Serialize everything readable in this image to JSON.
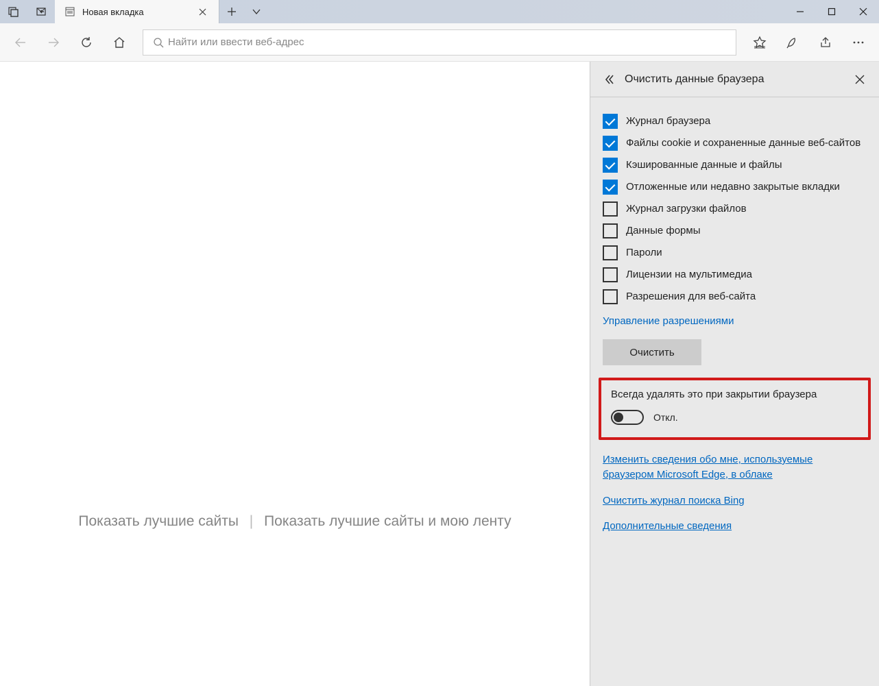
{
  "titlebar": {
    "tab_title": "Новая вкладка"
  },
  "toolbar": {
    "address_placeholder": "Найти или ввести веб-адрес"
  },
  "content": {
    "link_top_sites": "Показать лучшие сайты",
    "link_top_sites_feed": "Показать лучшие сайты и мою ленту"
  },
  "panel": {
    "title": "Очистить данные браузера",
    "checks": [
      {
        "label": "Журнал браузера",
        "checked": true
      },
      {
        "label": "Файлы cookie и сохраненные данные веб-сайтов",
        "checked": true
      },
      {
        "label": "Кэшированные данные и файлы",
        "checked": true
      },
      {
        "label": "Отложенные или недавно закрытые вкладки",
        "checked": true
      },
      {
        "label": "Журнал загрузки файлов",
        "checked": false
      },
      {
        "label": "Данные формы",
        "checked": false
      },
      {
        "label": "Пароли",
        "checked": false
      },
      {
        "label": "Лицензии на мультимедиа",
        "checked": false
      },
      {
        "label": "Разрешения для веб-сайта",
        "checked": false
      }
    ],
    "manage_permissions": "Управление разрешениями",
    "clear_button": "Очистить",
    "always_clear_title": "Всегда удалять это при закрытии браузера",
    "toggle_label": "Откл.",
    "links": {
      "change_info": "Изменить сведения обо мне, используемые браузером Microsoft Edge, в облаке",
      "clear_bing": "Очистить журнал поиска Bing",
      "more_info": "Дополнительные сведения"
    }
  }
}
